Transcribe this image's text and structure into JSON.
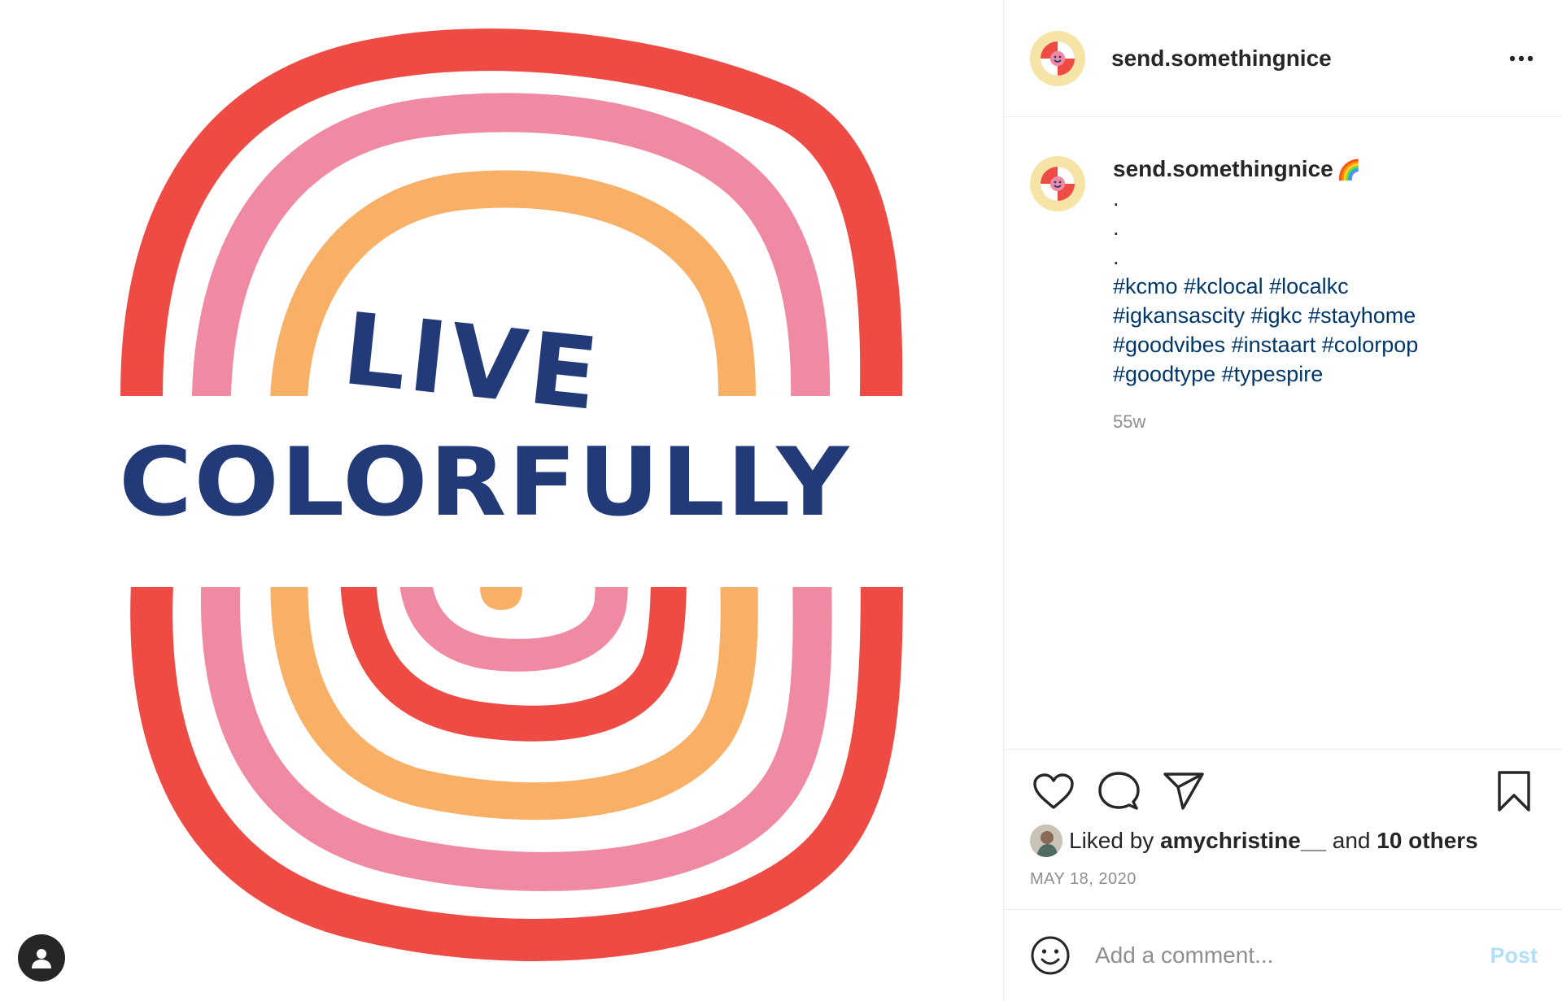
{
  "post": {
    "username": "send.somethingnice",
    "artwork_text": {
      "line1": "LIVE",
      "line2": "COLORFULLY"
    },
    "caption": {
      "username": "send.somethingnice",
      "emoji": "🌈",
      "dots": [
        ".",
        ".",
        "."
      ],
      "hashtag_lines": [
        [
          "#kcmo",
          "#kclocal",
          "#localkc"
        ],
        [
          "#igkansascity",
          "#igkc",
          "#stayhome"
        ],
        [
          "#goodvibes",
          "#instaart",
          "#colorpop"
        ],
        [
          "#goodtype",
          "#typespire"
        ]
      ],
      "age": "55w"
    },
    "likes": {
      "prefix": "Liked by",
      "user": "amychristine__",
      "joiner": "and",
      "others": "10 others"
    },
    "date": "MAY 18, 2020",
    "comment": {
      "placeholder": "Add a comment...",
      "post_label": "Post"
    }
  },
  "icons": {
    "more": "more-options-icon",
    "like": "heart-icon",
    "comment": "comment-bubble-icon",
    "share": "paper-plane-icon",
    "save": "bookmark-icon",
    "emoji": "smiley-icon",
    "tagged_users": "user-icon"
  },
  "colors": {
    "red": "#ef4b45",
    "pink": "#f08aa2",
    "orange": "#f8b066",
    "navy": "#223a78",
    "link": "#00376b",
    "muted": "#8e8e8e",
    "post_disabled": "#b2dffc"
  }
}
